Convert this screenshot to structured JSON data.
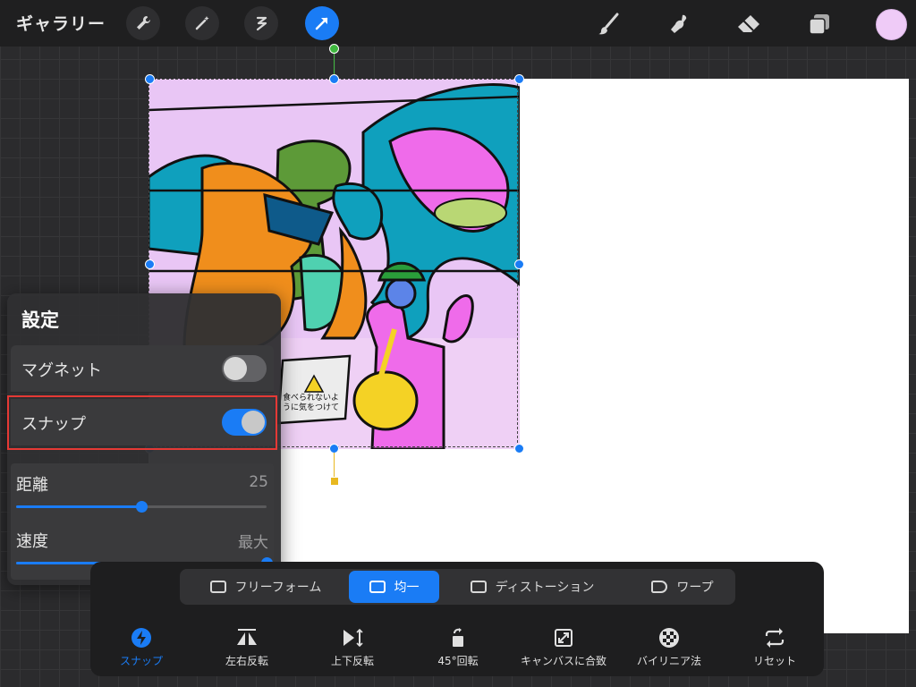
{
  "topbar": {
    "gallery_label": "ギャラリー",
    "tools_left": [
      "wrench-icon",
      "magic-wand-icon",
      "selection-icon",
      "transform-arrow-icon"
    ],
    "tools_right": [
      "brush-icon",
      "smudge-icon",
      "eraser-icon",
      "layers-icon"
    ],
    "current_color": "#efcbf7"
  },
  "settings": {
    "title": "設定",
    "magnet_label": "マグネット",
    "magnet_on": false,
    "snap_label": "スナップ",
    "snap_on": true,
    "distance_label": "距離",
    "distance_value": "25",
    "distance_fraction": 0.5,
    "speed_label": "速度",
    "speed_value": "最大",
    "speed_fraction": 1.0
  },
  "artwork": {
    "sign_text": "食べられないよ\nうに気をつけて"
  },
  "modes": {
    "freeform": "フリーフォーム",
    "uniform": "均一",
    "distort": "ディストーション",
    "warp": "ワープ"
  },
  "actions": {
    "snap": "スナップ",
    "flip_h": "左右反転",
    "flip_v": "上下反転",
    "rotate45": "45°回転",
    "fit_canvas": "キャンバスに合致",
    "bilinear": "バイリニア法",
    "reset": "リセット"
  },
  "colors": {
    "accent": "#1a7cf5",
    "highlight": "#e53935"
  }
}
